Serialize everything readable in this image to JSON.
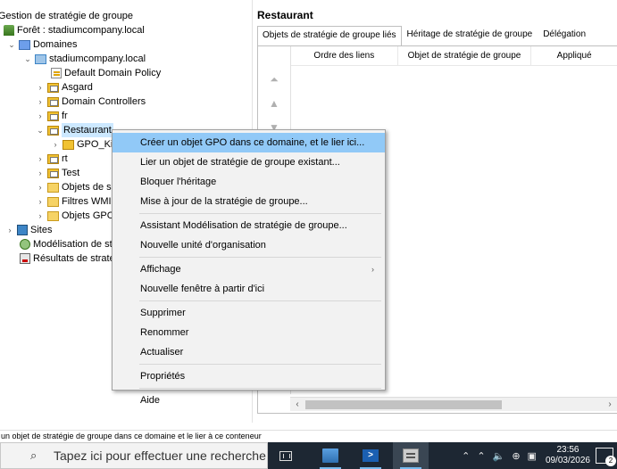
{
  "tree": {
    "rows": [
      {
        "label": "Gestion de stratégie de groupe",
        "icon": "gpm-root-icon"
      },
      {
        "label": "Forêt : stadiumcompany.local",
        "icon": "forest-icon"
      },
      {
        "label": "Domaines",
        "icon": "domains-icon"
      },
      {
        "label": "stadiumcompany.local",
        "icon": "domain-icon"
      },
      {
        "label": "Default Domain Policy",
        "icon": "gpo-link-icon"
      },
      {
        "label": "Asgard",
        "icon": "ou-icon"
      },
      {
        "label": "Domain Controllers",
        "icon": "ou-icon"
      },
      {
        "label": "fr",
        "icon": "ou-icon"
      },
      {
        "label": "Restaurant",
        "icon": "ou-icon"
      },
      {
        "label": "GPO_Ki",
        "icon": "gpo-link-icon"
      },
      {
        "label": "rt",
        "icon": "ou-icon"
      },
      {
        "label": "Test",
        "icon": "ou-icon"
      },
      {
        "label": "Objets de s",
        "icon": "folder-icon"
      },
      {
        "label": "Filtres WMI",
        "icon": "folder-icon"
      },
      {
        "label": "Objets GPC",
        "icon": "folder-icon"
      },
      {
        "label": "Sites",
        "icon": "sites-icon"
      },
      {
        "label": "Modélisation de st",
        "icon": "modeling-icon"
      },
      {
        "label": "Résultats de straté",
        "icon": "results-icon"
      }
    ]
  },
  "right": {
    "title": "Restaurant",
    "tabs": [
      "Objets de stratégie de groupe liés",
      "Héritage de stratégie de groupe",
      "Délégation"
    ],
    "columns": [
      "Ordre des liens",
      "Objet de stratégie de groupe",
      "Appliqué"
    ]
  },
  "context_menu": {
    "items": [
      "Créer un objet GPO dans ce domaine, et le lier ici...",
      "Lier un objet de stratégie de groupe existant...",
      "Bloquer l'héritage",
      "Mise à jour de la stratégie de groupe...",
      "Assistant Modélisation de stratégie de groupe...",
      "Nouvelle unité d'organisation",
      "Affichage",
      "Nouvelle fenêtre à partir d'ici",
      "Supprimer",
      "Renommer",
      "Actualiser",
      "Propriétés",
      "Aide"
    ],
    "highlighted_index": 0,
    "submenu_arrow": "›"
  },
  "status_bar": {
    "text": "un objet de stratégie de groupe dans ce domaine et le lier à ce conteneur"
  },
  "taskbar": {
    "search_placeholder": "Tapez ici pour effectuer une recherche",
    "clock_time": "23:56",
    "clock_date": "09/03/2026",
    "notification_count": "2"
  },
  "colors": {
    "highlight": "#91c9f7",
    "selected": "#cce8ff",
    "taskbar": "#1d2733"
  }
}
